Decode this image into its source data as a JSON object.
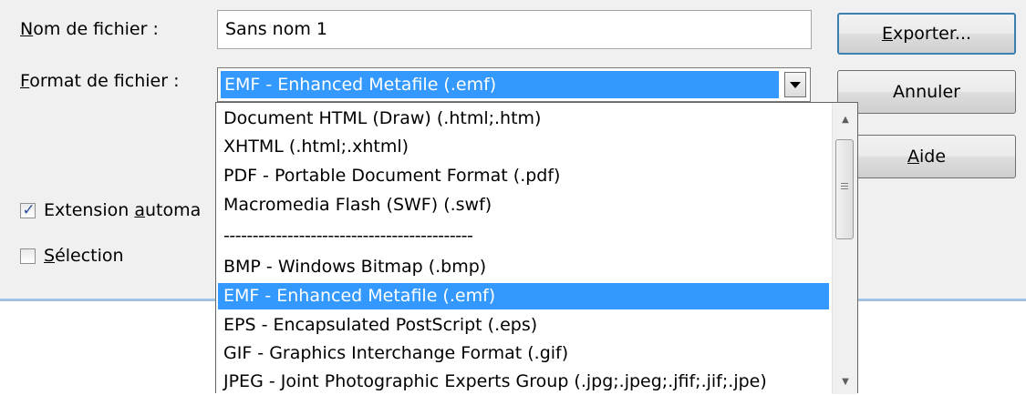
{
  "file_name": {
    "label_underlined": "N",
    "label_rest": "om de fichier :",
    "value": "Sans nom 1"
  },
  "file_format": {
    "label_underlined": "F",
    "label_rest": "ormat de fichier :",
    "selected": "EMF - Enhanced Metafile (.emf)"
  },
  "buttons": {
    "export_underlined": "E",
    "export_rest": "xporter...",
    "cancel": "Annuler",
    "help_underlined": "A",
    "help_rest": "ide"
  },
  "options": {
    "auto_extension_pre": "Extension ",
    "auto_extension_underlined": "a",
    "auto_extension_rest": "utoma",
    "auto_extension_checked": true,
    "selection_underlined": "S",
    "selection_rest": "élection",
    "selection_checked": false
  },
  "dropdown": {
    "items": [
      "Document HTML (Draw) (.html;.htm)",
      "XHTML (.html;.xhtml)",
      "PDF - Portable Document Format (.pdf)",
      "Macromedia Flash (SWF) (.swf)",
      "-------------------------------------------",
      "BMP - Windows Bitmap (.bmp)",
      "EMF - Enhanced Metafile (.emf)",
      "EPS - Encapsulated PostScript (.eps)",
      "GIF - Graphics Interchange Format (.gif)",
      "JPEG - Joint Photographic Experts Group (.jpg;.jpeg;.jfif;.jif;.jpe)"
    ],
    "selected_index": 6
  },
  "icons": {
    "check": "✓",
    "scroll_up": "▲",
    "scroll_down": "▼"
  },
  "colors": {
    "selection": "#3399ff",
    "dialog_bg": "#f0f0f0"
  }
}
